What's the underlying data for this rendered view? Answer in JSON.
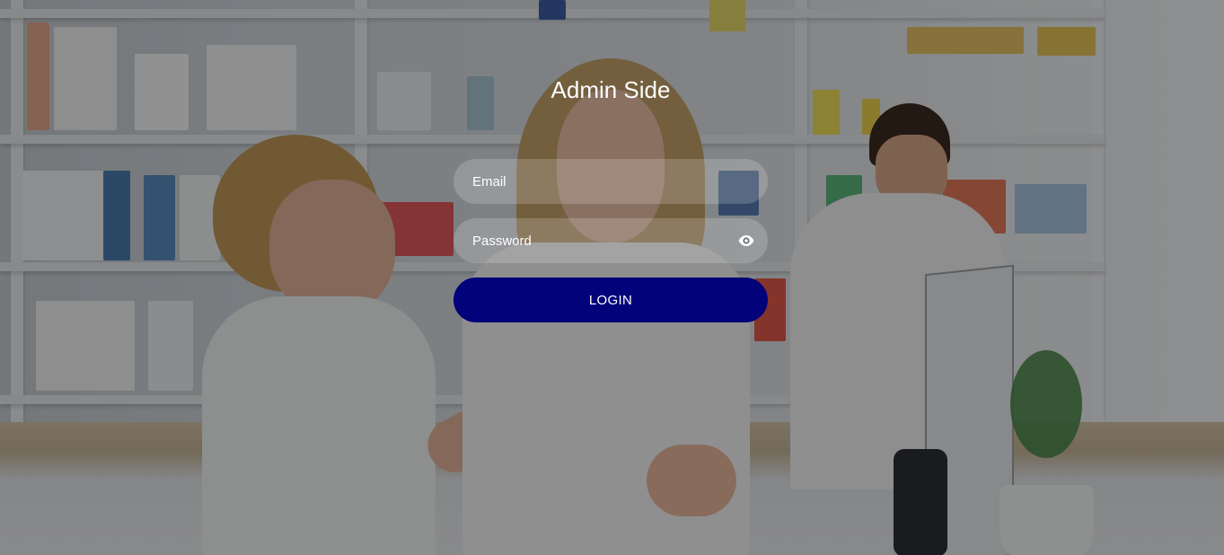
{
  "page": {
    "title": "Admin Side"
  },
  "form": {
    "email_placeholder": "Email",
    "password_placeholder": "Password",
    "login_label": "LOGIN",
    "password_toggle_icon": "eye-icon"
  },
  "colors": {
    "button_bg": "#02027a",
    "text": "#ffffff",
    "field_bg": "rgba(255,255,255,0.18)"
  },
  "background": {
    "image": "pharmacy-staff-photo"
  }
}
